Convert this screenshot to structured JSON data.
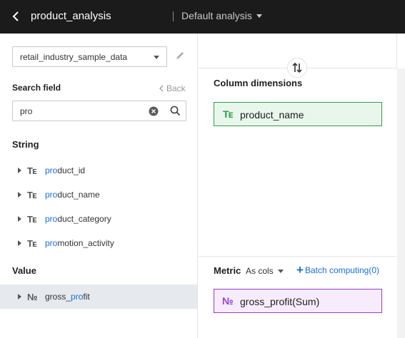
{
  "header": {
    "title": "product_analysis",
    "analysis_selector": "Default analysis",
    "back_icon": "chevron-left-icon"
  },
  "left_panel": {
    "dataset": "retail_industry_sample_data",
    "search_label": "Search field",
    "back_label": "Back",
    "search_value": "pro",
    "sections": {
      "string_title": "String",
      "value_title": "Value"
    },
    "string_fields": [
      {
        "match": "pro",
        "rest": "duct_id",
        "icon": "Tᴇ"
      },
      {
        "match": "pro",
        "rest": "duct_name",
        "icon": "Tᴇ"
      },
      {
        "match": "pro",
        "rest": "duct_category",
        "icon": "Tᴇ"
      },
      {
        "match": "pro",
        "rest": "motion_activity",
        "icon": "Tᴇ"
      }
    ],
    "value_fields": [
      {
        "before": "gross_",
        "match": "pro",
        "after": "fit",
        "icon": "№"
      }
    ]
  },
  "right_panel": {
    "column_dimensions_label": "Column dimensions",
    "column_dimension": "product_name",
    "metric_label": "Metric",
    "metric_mode": "As cols",
    "batch_computing": "Batch computing(0)",
    "metric": "gross_profit(Sum)"
  },
  "colors": {
    "header_bg": "#1b1b1b",
    "accent_blue": "#1a6edc",
    "dimension_green": "#2e9f4a",
    "metric_purple": "#9b3cc7",
    "selected_row": "#e6e9ee"
  }
}
